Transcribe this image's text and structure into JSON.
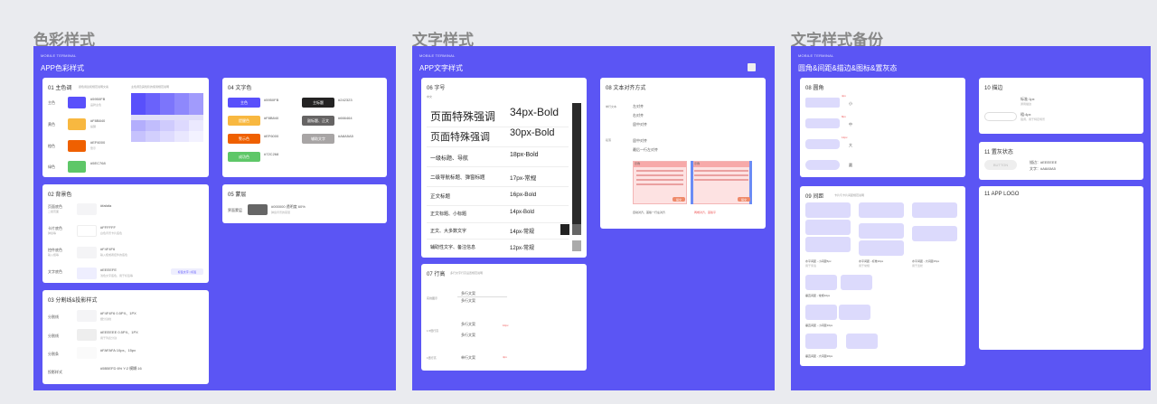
{
  "sections": [
    "色彩样式",
    "文字样式",
    "文字样式备份"
  ],
  "boards": [
    {
      "sub": "MOBILE TERMINAL",
      "title": "APP色彩样式"
    },
    {
      "sub": "MOBILE TERMINAL",
      "title": "APP文字样式"
    },
    {
      "sub": "MOBILE TERMINAL",
      "title": "圆角&间距&描边&图标&置灰态"
    }
  ],
  "colors": {
    "board": "#5b55f4",
    "primary": "#5950FB",
    "yellow": "#F8B840",
    "orange": "#EF6000",
    "green": "#5EC768"
  },
  "c01": {
    "title": "01 主色调",
    "note": "颜色用途和规范说明文案",
    "note2": "主色调及其色阶的使用规范说明",
    "rows": [
      {
        "label": "主色",
        "hex": "#5950FB",
        "desc": "品牌主色"
      },
      {
        "label": "黄色",
        "hex": "#F8B840",
        "desc": "提醒"
      },
      {
        "label": "橙色",
        "hex": "#EF6000",
        "desc": "警示"
      },
      {
        "label": "绿色",
        "hex": "#5EC768",
        "desc": ""
      }
    ]
  },
  "c02": {
    "title": "02 背景色",
    "rows": [
      {
        "label": "页面底色",
        "sub": "二级页面",
        "hex": "#fafafa",
        "desc": ""
      },
      {
        "label": "卡片底色",
        "sub": "弹窗等",
        "hex": "#FFFFFF",
        "desc": "白色背景卡片底色"
      },
      {
        "label": "控件底色",
        "sub": "输入框等",
        "hex": "#F4F4F6",
        "desc": "输入框或者控件的底色"
      },
      {
        "label": "文字底色",
        "sub": "",
        "hex": "#EEEEFE",
        "desc": "浅色文字底色，用于标签等"
      }
    ],
    "tag": "标签文字 | 标签"
  },
  "c03": {
    "title": "03 分割线&投影样式",
    "rows": [
      {
        "label": "分割线",
        "value": "#F4F4F6 0.5PX、1PX",
        "desc": "细分割线"
      },
      {
        "label": "分割线",
        "value": "#EEEEEE 0.5PX、1PX",
        "desc": "用于列表分割"
      },
      {
        "label": "分割条",
        "value": "#FAFAFA 10px、15px",
        "desc": ""
      },
      {
        "label": "投影样式",
        "value": "#5B5EFD 6% Y:2 模糊:16",
        "desc": ""
      }
    ]
  },
  "c04": {
    "title": "04 文字色",
    "buttons": [
      {
        "label": "主色",
        "hex": "#5950FB"
      },
      {
        "label": "提醒色",
        "hex": "#F8B840"
      },
      {
        "label": "警示色",
        "hex": "#EF6000"
      },
      {
        "label": "成功色",
        "hex": "#72C268"
      }
    ],
    "text_buttons": [
      {
        "label": "主标题",
        "hex": "#242323"
      },
      {
        "label": "副标题、正文",
        "hex": "#666464"
      },
      {
        "label": "辅助文字",
        "hex": "#A8A5A5"
      }
    ]
  },
  "c05": {
    "title": "05 蒙层",
    "label": "界面蒙层",
    "value": "#000000 透明度 60%",
    "desc": "弹窗背景的蒙层"
  },
  "c06": {
    "title": "06 字号",
    "lang": "中文",
    "rows": [
      {
        "sample": "页面特殊强调",
        "size": "34px-Bold"
      },
      {
        "sample": "页面特殊强调",
        "size": "30px-Bold"
      },
      {
        "sample": "一级标题、导航",
        "size": "18px-Bold"
      },
      {
        "sample": "二级导航标题、弹窗标题",
        "size": "17px-常规"
      },
      {
        "sample": "正文标题",
        "size": "16px-Bold"
      },
      {
        "sample": "正文标题、小标题",
        "size": "14px-Bold"
      },
      {
        "sample": "正文、大多数文字",
        "size": "14px-常规"
      },
      {
        "sample": "辅助性文字、备注信息",
        "size": "12px-常规"
      }
    ]
  },
  "c07": {
    "title": "07 行高",
    "note": "多行文字行高设置规范说明",
    "rows": [
      {
        "label": "实线图示",
        "lines": [
          "多行文案",
          "多行文案"
        ],
        "mark": ""
      },
      {
        "label": "1.5倍行高",
        "lines": [
          "多行文案",
          "多行文案"
        ],
        "mark": "10px"
      },
      {
        "label": "1倍行高",
        "lines": [
          "单行文案"
        ],
        "mark": "4px"
      }
    ]
  },
  "c08": {
    "title": "08 文本对齐方式",
    "single_label": "单行文本",
    "single": [
      "左对齐",
      "右对齐",
      "居中对齐"
    ],
    "multi_label": "段落",
    "multi": [
      "居中对齐",
      "最后一行左对齐"
    ],
    "demo_l": "示例",
    "demo_r": "示例",
    "demo_cap_l": "自动对齐，首版一行左对齐",
    "demo_cap_r": "两端对齐，首版平",
    "demo_btn_l": "提交",
    "demo_btn_r": "提交"
  },
  "c08r": {
    "title": "08 圆角",
    "radii": [
      "小",
      "中",
      "大",
      "圆"
    ],
    "marks": [
      "4px",
      "8px",
      "12px"
    ]
  },
  "c09": {
    "title": "09 间距",
    "note": "卡片与卡片间距规范说明",
    "caps": [
      {
        "t": "水平间距 - 小间距5px",
        "s": "用于紧凑"
      },
      {
        "t": "水平间距 - 标准10px",
        "s": "用于常规"
      },
      {
        "t": "水平间距 - 大间距15px",
        "s": "用于宽松"
      }
    ],
    "vcaps": [
      "垂直间距 - 常规10px",
      "垂直间距 - 小间距10px",
      "垂直间距 - 大间距20px"
    ]
  },
  "c10": {
    "title": "10 描边",
    "w1": "标准:1px",
    "w1d": "通用描边",
    "w2": "粗:4px",
    "w2d": "强调，用于特定场景"
  },
  "c11": {
    "title": "11 置灰状态",
    "button": "BUTTON",
    "fill": "描边：#EEEEEE",
    "text": "文字：#A8A5A5"
  },
  "c12": {
    "title": "11 APP LOGO"
  }
}
